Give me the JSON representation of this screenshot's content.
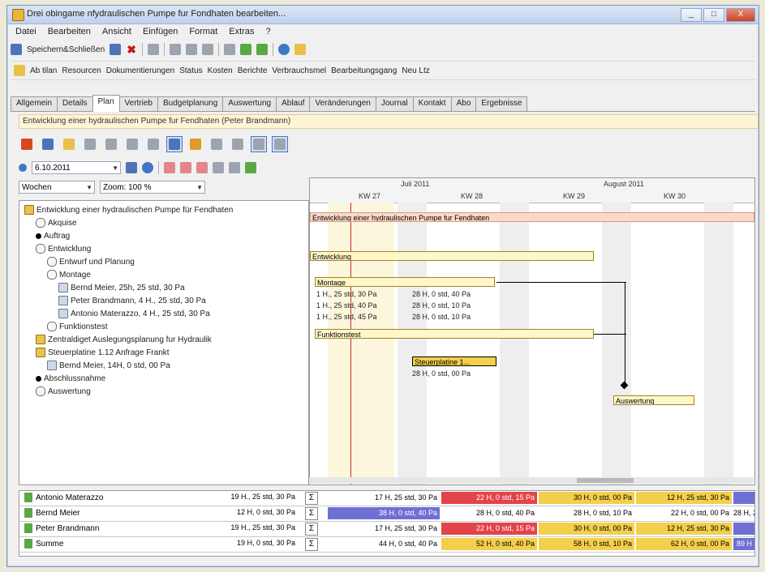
{
  "window": {
    "title": "Drei obingame nfydraulischen Pumpe fur Fondhaten bearbeiten...",
    "buttons": {
      "minimize": "_",
      "maximize": "□",
      "close": "X"
    }
  },
  "menu": [
    "Datei",
    "Bearbeiten",
    "Ansicht",
    "Einfügen",
    "Format",
    "Extras",
    "?"
  ],
  "toolbar1": {
    "save_close": "Speichern&Schließen"
  },
  "toolbar2": {
    "items": [
      "Ab tilan",
      "Resourcen",
      "Dokumentierungen",
      "Status",
      "Kosten",
      "Berichte",
      "Verbrauchsmel",
      "Bearbeitungsgang",
      "Neu Ltz"
    ]
  },
  "tabs": [
    "Allgemein",
    "Details",
    "Plan",
    "Vertrieb",
    "Budgetplanung",
    "Auswertung",
    "Ablauf",
    "Veränderungen",
    "Journal",
    "Kontakt",
    "Abo",
    "Ergebnisse"
  ],
  "active_tab": "Plan",
  "hint": "Entwicklung einer hydraulischen Pumpe fur Fendhaten (Peter Brandmann)",
  "date_control": {
    "date": "6.10.2011"
  },
  "view_control": {
    "mode": "Wochen",
    "zoom": "Zoom: 100 %"
  },
  "tree": [
    {
      "label": "Entwicklung einer hydraulischen Pumpe für Fendhaten",
      "icon": "task",
      "indent": 0
    },
    {
      "label": "Akquise",
      "icon": "circle",
      "indent": 1
    },
    {
      "label": "Auftrag",
      "icon": "milestone",
      "indent": 1
    },
    {
      "label": "Entwicklung",
      "icon": "circle",
      "indent": 1
    },
    {
      "label": "Entwurf und Planung",
      "icon": "circle",
      "indent": 2
    },
    {
      "label": "Montage",
      "icon": "circle",
      "indent": 2
    },
    {
      "label": "Bernd Meier, 25h, 25 std, 30 Pa",
      "icon": "res",
      "indent": 3
    },
    {
      "label": "Peter Brandmann, 4 H., 25 std, 30 Pa",
      "icon": "res",
      "indent": 3
    },
    {
      "label": "Antonio Materazzo, 4 H., 25 std, 30 Pa",
      "icon": "res",
      "indent": 3
    },
    {
      "label": "Funktionstest",
      "icon": "circle",
      "indent": 2
    },
    {
      "label": "Zentraldiget Auslegungsplanung fur Hydraulik",
      "icon": "task",
      "indent": 1
    },
    {
      "label": "Steuerplatine 1.12 Anfrage Frankt",
      "icon": "task",
      "indent": 1
    },
    {
      "label": "Bernd Meier, 14H, 0 std, 00 Pa",
      "icon": "res",
      "indent": 2
    },
    {
      "label": "Abschlussnahme",
      "icon": "milestone",
      "indent": 1
    },
    {
      "label": "Auswertung",
      "icon": "circle",
      "indent": 1
    }
  ],
  "gantt": {
    "months": [
      "Juli 2011",
      "August 2011"
    ],
    "weeks": [
      "KW 27",
      "KW 28",
      "KW 29",
      "KW 30"
    ],
    "labels": {
      "project": "Entwicklung einer hydraulischen Pumpe fur Fendhaten",
      "entwicklung": "Entwicklung",
      "montage": "Montage",
      "m1": "1 H., 25 std, 30 Pa",
      "m2": "1 H., 25 std, 40 Pa",
      "m3": "1 H., 25 std, 45 Pa",
      "m1r": "28 H, 0 std, 40 Pa",
      "m2r": "28 H, 0 std, 10 Pa",
      "m3r": "28 H, 0 std, 10 Pa",
      "funktionstest": "Funktionstest",
      "steuer": "Steuerplatine 1...",
      "steuer_res": "28 H, 0 std, 00 Pa",
      "auswertung": "Auswertung"
    }
  },
  "resources": [
    {
      "name": "Antonio Materazzo",
      "sum": "19 H., 25 std, 30 Pa",
      "cells": [
        "17 H, 25 std, 30 Pa",
        "22 H, 0 std, 15 Pa",
        "30 H, 0 std, 00 Pa",
        "12 H, 25 std, 30 Pa",
        ""
      ]
    },
    {
      "name": "Bernd Meier",
      "sum": "12 H, 0 std, 30 Pa",
      "cells": [
        "38 H, 0 std, 40 Pa",
        "28 H, 0 std, 40 Pa",
        "28 H, 0 std, 10 Pa",
        "22 H, 0 std, 00 Pa",
        "28 H, 22"
      ]
    },
    {
      "name": "Peter Brandmann",
      "sum": "19 H., 25 std, 30 Pa",
      "cells": [
        "17 H, 25 std, 30 Pa",
        "22 H, 0 std, 15 Pa",
        "30 H, 0 std, 00 Pa",
        "12 H, 25 std, 30 Pa",
        ""
      ]
    },
    {
      "name": "Summe",
      "sum": "19 H, 0 std, 30 Pa",
      "cells": [
        "44 H, 0 std, 40 Pa",
        "52 H, 0 std, 40 Pa",
        "58 H, 0 std, 10 Pa",
        "62 H, 0 std, 00 Pa",
        "89 H"
      ]
    }
  ],
  "colors": {
    "red": "#e2444a",
    "yellow": "#f4cf4c",
    "blue": "#6f6fd4",
    "weekend": "#eeeeee",
    "today_line": "#c8321f"
  }
}
